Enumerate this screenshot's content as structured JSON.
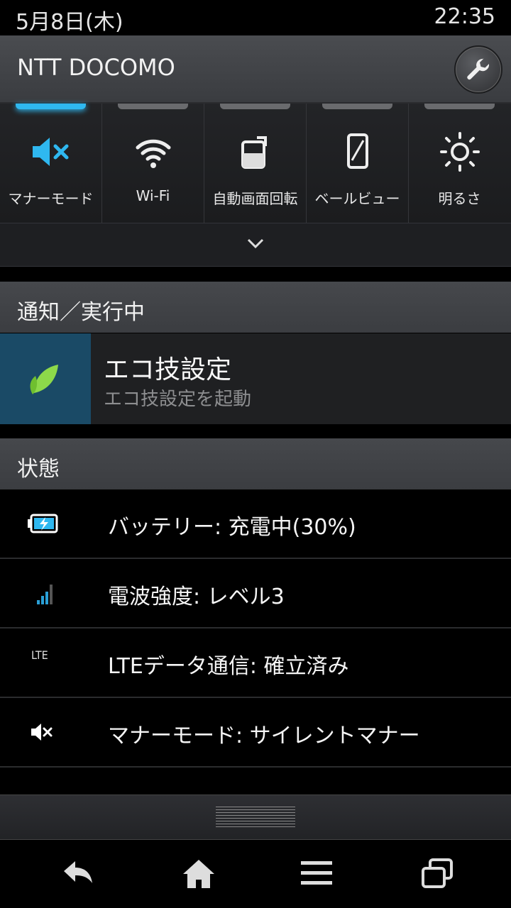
{
  "status_bar": {
    "date": "5月8日(木)",
    "time": "22:35"
  },
  "header": {
    "carrier": "NTT DOCOMO",
    "settings_icon": "wrench-icon"
  },
  "quick_toggles": [
    {
      "label": "マナーモード",
      "icon": "mute-icon",
      "active": true
    },
    {
      "label": "Wi-Fi",
      "icon": "wifi-icon",
      "active": false
    },
    {
      "label": "自動画面回転",
      "icon": "rotate-icon",
      "active": false
    },
    {
      "label": "ベールビュー",
      "icon": "veilview-icon",
      "active": false
    },
    {
      "label": "明るさ",
      "icon": "brightness-icon",
      "active": false
    }
  ],
  "notifications_section": {
    "title": "通知／実行中",
    "items": [
      {
        "title": "エコ技設定",
        "subtitle": "エコ技設定を起動",
        "icon": "leaf-icon"
      }
    ]
  },
  "status_section": {
    "title": "状態",
    "rows": [
      {
        "icon": "battery-charging-icon",
        "text": "バッテリー: 充電中(30%)"
      },
      {
        "icon": "signal-icon",
        "text": "電波強度: レベル3"
      },
      {
        "icon": "lte-icon",
        "icon_text": "LTE",
        "text": "LTEデータ通信: 確立済み"
      },
      {
        "icon": "mute-icon",
        "text": "マナーモード: サイレントマナー"
      }
    ]
  },
  "colors": {
    "accent": "#2fb8f0"
  }
}
